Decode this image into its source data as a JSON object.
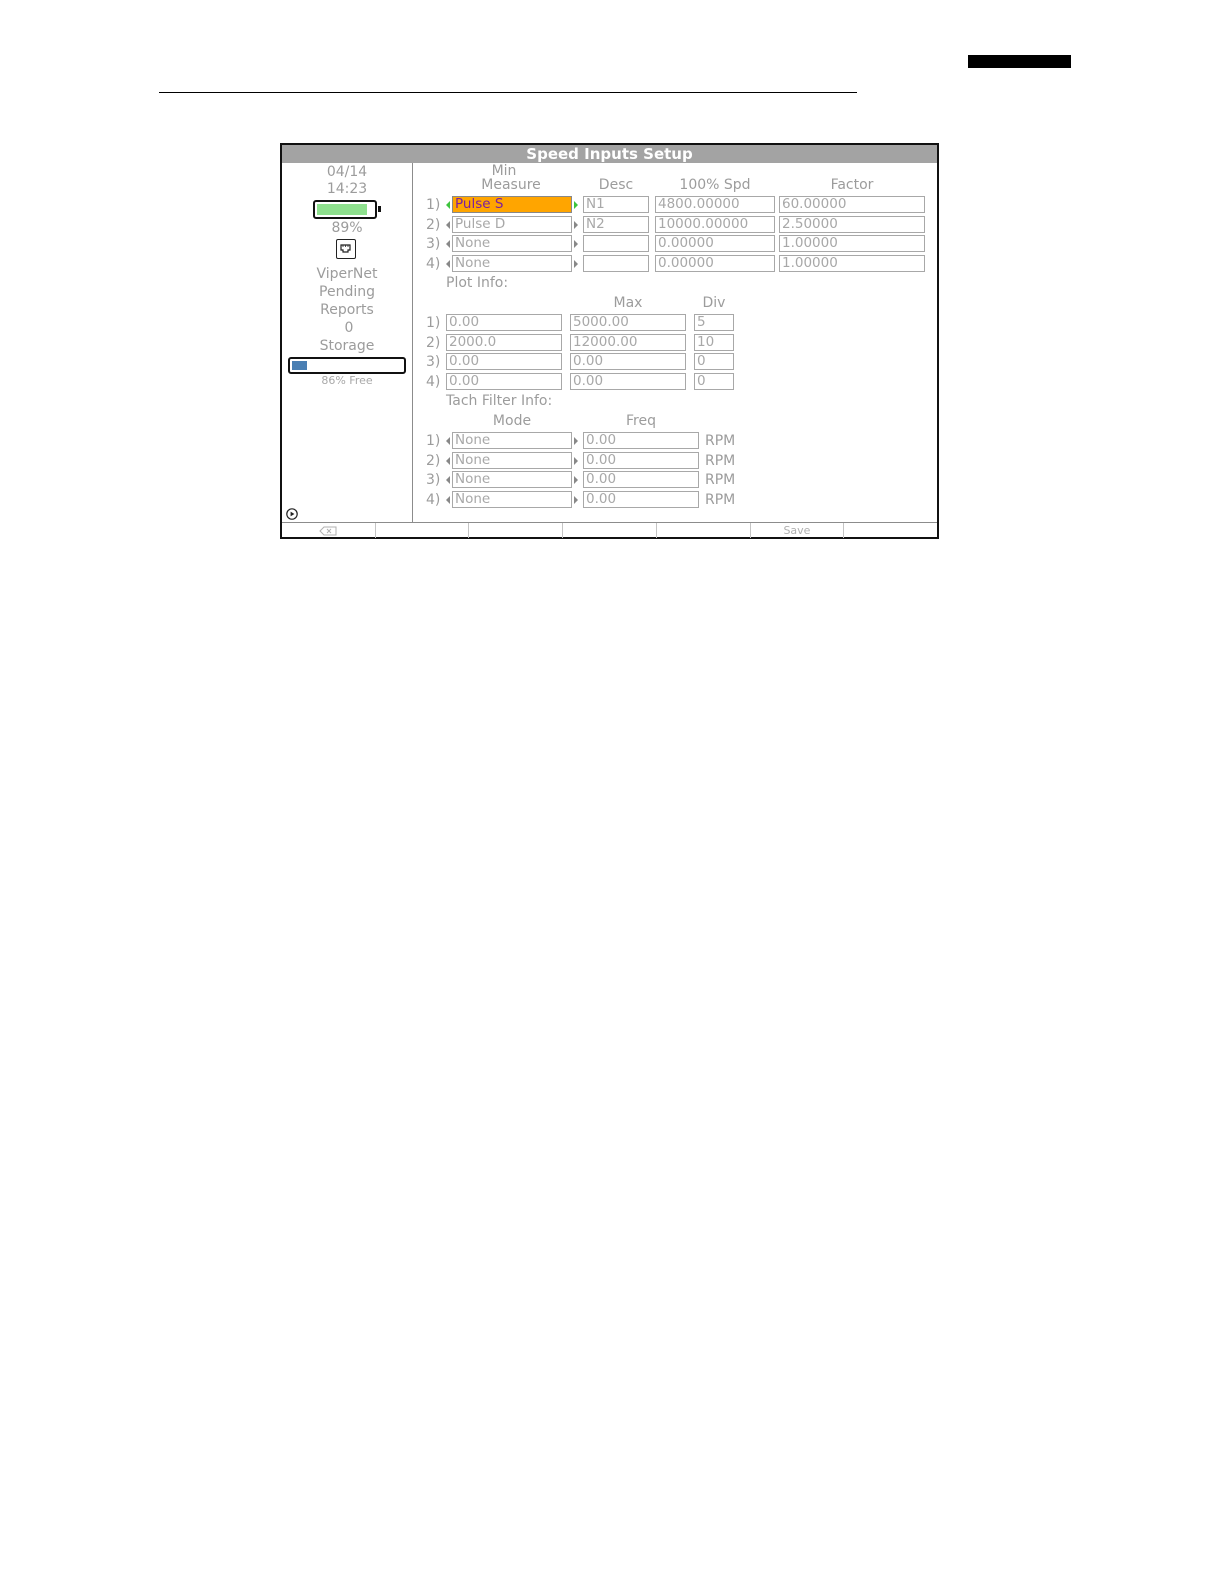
{
  "screen": {
    "title": "Speed Inputs Setup"
  },
  "sidebar": {
    "date": "04/14",
    "time": "14:23",
    "battery_percent": 89,
    "battery_label": "89%",
    "net_icon": "ethernet-port-icon",
    "vipernet_label": "ViperNet",
    "pending_label": "Pending",
    "reports_label": "Reports",
    "pending_count": "0",
    "storage_label": "Storage",
    "storage_used_fraction": 0.14,
    "storage_free_label": "86% Free",
    "play_icon": "play-circle-icon"
  },
  "speed_inputs": {
    "headers": {
      "measure": "Measure",
      "desc": "Desc",
      "spd": "100% Spd",
      "factor": "Factor"
    },
    "rows": [
      {
        "num": "1)",
        "measure": "Pulse S",
        "desc": "N1",
        "spd": "4800.00000",
        "factor": "60.00000"
      },
      {
        "num": "2)",
        "measure": "Pulse D",
        "desc": "N2",
        "spd": "10000.00000",
        "factor": "2.50000"
      },
      {
        "num": "3)",
        "measure": "None",
        "desc": "",
        "spd": "0.00000",
        "factor": "1.00000"
      },
      {
        "num": "4)",
        "measure": "None",
        "desc": "",
        "spd": "0.00000",
        "factor": "1.00000"
      }
    ]
  },
  "plot_info": {
    "title": "Plot Info:",
    "headers": {
      "min": "Min",
      "max": "Max",
      "div": "Div"
    },
    "rows": [
      {
        "num": "1)",
        "min": "0.00",
        "max": "5000.00",
        "div": "5"
      },
      {
        "num": "2)",
        "min": "2000.0",
        "max": "12000.00",
        "div": "10"
      },
      {
        "num": "3)",
        "min": "0.00",
        "max": "0.00",
        "div": "0"
      },
      {
        "num": "4)",
        "min": "0.00",
        "max": "0.00",
        "div": "0"
      }
    ]
  },
  "tach_filter": {
    "title": "Tach Filter Info:",
    "headers": {
      "mode": "Mode",
      "freq": "Freq"
    },
    "unit": "RPM",
    "rows": [
      {
        "num": "1)",
        "mode": "None",
        "freq": "0.00"
      },
      {
        "num": "2)",
        "mode": "None",
        "freq": "0.00"
      },
      {
        "num": "3)",
        "mode": "None",
        "freq": "0.00"
      },
      {
        "num": "4)",
        "mode": "None",
        "freq": "0.00"
      }
    ]
  },
  "softkeys": {
    "backspace_icon": "backspace-icon",
    "save": "Save"
  },
  "colors": {
    "title_bar": "#a3a3a3",
    "selected_field": "#ffa500",
    "selected_text": "#7a1fa0",
    "battery_fill": "#8ee08e",
    "storage_fill": "#4a7fb3",
    "active_arrow": "#3ec43e"
  }
}
